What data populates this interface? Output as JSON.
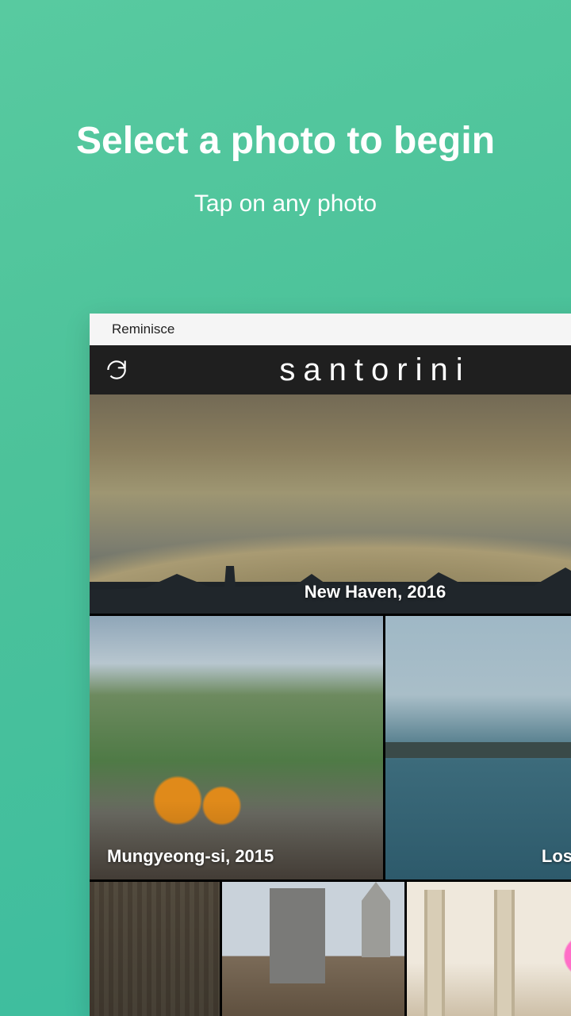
{
  "promo": {
    "headline": "Select a photo to begin",
    "subhead": "Tap on any photo"
  },
  "app": {
    "window_title": "Reminisce",
    "toolbar_title": "santorini",
    "photos": {
      "hero_caption": "New Haven, 2016",
      "r2a_caption": "Mungyeong-si, 2015",
      "r2b_caption": "Los Angeles,"
    }
  }
}
